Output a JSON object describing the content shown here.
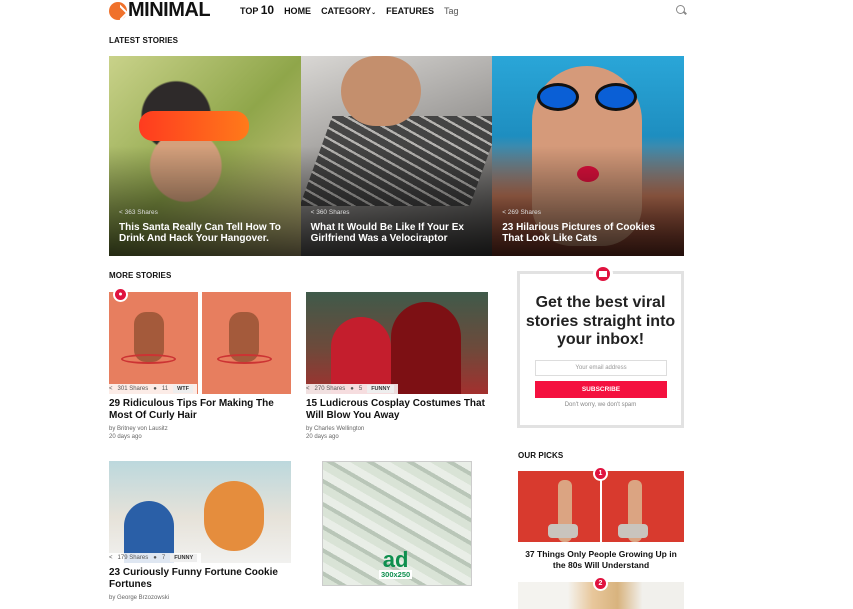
{
  "header": {
    "logo": "MINIMAL",
    "nav": {
      "top_prefix": "TOP",
      "top_num": "10",
      "home": "HOME",
      "category": "CATEGORY",
      "features": "FEATURES",
      "tag": "Tag"
    }
  },
  "sections": {
    "latest": "LATEST STORIES",
    "more": "MORE STORIES",
    "picks": "OUR PICKS"
  },
  "latest": [
    {
      "shares": "363 Shares",
      "title": "This Santa Really Can Tell How To Drink And Hack Your Hangover."
    },
    {
      "shares": "360 Shares",
      "title": "What It Would Be Like If Your Ex Girlfriend Was a Velociraptor"
    },
    {
      "shares": "269 Shares",
      "title": "23 Hilarious Pictures of Cookies That Look Like Cats"
    }
  ],
  "more": [
    {
      "shares": "301 Shares",
      "comments": "11",
      "tag": "WTF",
      "title": "29 Ridiculous Tips For Making The Most Of Curly Hair",
      "by": "by Britney von Lausitz",
      "when": "20 days ago"
    },
    {
      "shares": "270 Shares",
      "comments": "5",
      "tag": "FUNNY",
      "title": "15 Ludicrous Cosplay Costumes That Will Blow You Away",
      "by": "by Charles Wellington",
      "when": "20 days ago"
    },
    {
      "shares": "179 Shares",
      "comments": "7",
      "tag": "FUNNY",
      "title": "23 Curiously Funny Fortune Cookie Fortunes",
      "by": "by George Brzozowski"
    }
  ],
  "ad": {
    "big": "ad",
    "size": "300x250"
  },
  "newsletter": {
    "heading": "Get the best viral stories straight into your inbox!",
    "placeholder": "Your email address",
    "button": "SUBSCRIBE",
    "note": "Don't worry, we don't spam"
  },
  "picks": [
    {
      "rank": "1",
      "title": "37 Things Only People Growing Up in the 80s Will Understand"
    },
    {
      "rank": "2"
    }
  ],
  "colors": {
    "accent": "#f4113f",
    "logo": "#f0712b"
  }
}
